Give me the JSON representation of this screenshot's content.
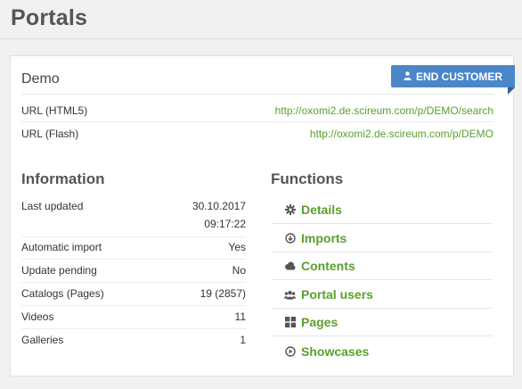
{
  "page": {
    "title": "Portals"
  },
  "portal": {
    "name": "Demo",
    "badge": "END CUSTOMER",
    "urls": [
      {
        "label": "URL (HTML5)",
        "value": "http://oxomi2.de.scireum.com/p/DEMO/search"
      },
      {
        "label": "URL (Flash)",
        "value": "http://oxomi2.de.scireum.com/p/DEMO"
      }
    ]
  },
  "information": {
    "title": "Information",
    "rows": [
      {
        "label": "Last updated",
        "value": "30.10.2017",
        "value2": "09:17:22"
      },
      {
        "label": "Automatic import",
        "value": "Yes"
      },
      {
        "label": "Update pending",
        "value": "No"
      },
      {
        "label": "Catalogs (Pages)",
        "value": "19 (2857)"
      },
      {
        "label": "Videos",
        "value": "11"
      },
      {
        "label": "Galleries",
        "value": "1"
      }
    ]
  },
  "functions": {
    "title": "Functions",
    "items": [
      {
        "label": "Details",
        "icon": "gear-icon"
      },
      {
        "label": "Imports",
        "icon": "download-circle-icon"
      },
      {
        "label": "Contents",
        "icon": "cloud-icon"
      },
      {
        "label": "Portal users",
        "icon": "users-icon"
      },
      {
        "label": "Pages",
        "icon": "grid-icon"
      },
      {
        "label": "Showcases",
        "icon": "play-circle-icon"
      }
    ]
  },
  "colors": {
    "link": "#5aa02c",
    "badge": "#4a86c8",
    "background": "#f1f1f1"
  }
}
